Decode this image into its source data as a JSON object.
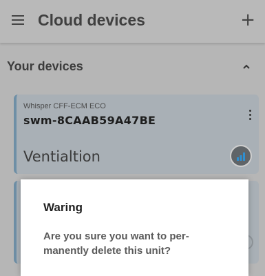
{
  "app_bar": {
    "title": "Cloud devices",
    "menu_icon": "hamburger-menu-icon",
    "add_icon": "plus-icon",
    "add_glyph": "+"
  },
  "section": {
    "title": "Your devices",
    "toggle_icon": "chevron-up-icon"
  },
  "devices": [
    {
      "model": "Whisper CFF-ECM ECO",
      "id": "swm-8CAAB59A47BE",
      "mode": "Ventialtion",
      "menu_icon": "kebab-menu-icon",
      "status_icon": "signal-strength-icon"
    }
  ],
  "dialog": {
    "title": "Waring",
    "message": "Are you sure you want to per-manently delete this unit?"
  },
  "colors": {
    "overlay_background": "#b6b6b6",
    "card_background": "#a9b0b6",
    "card_accent": "#6e8fa6",
    "signal_bars": "#2f8fd0",
    "dialog_background": "#ffffff"
  }
}
